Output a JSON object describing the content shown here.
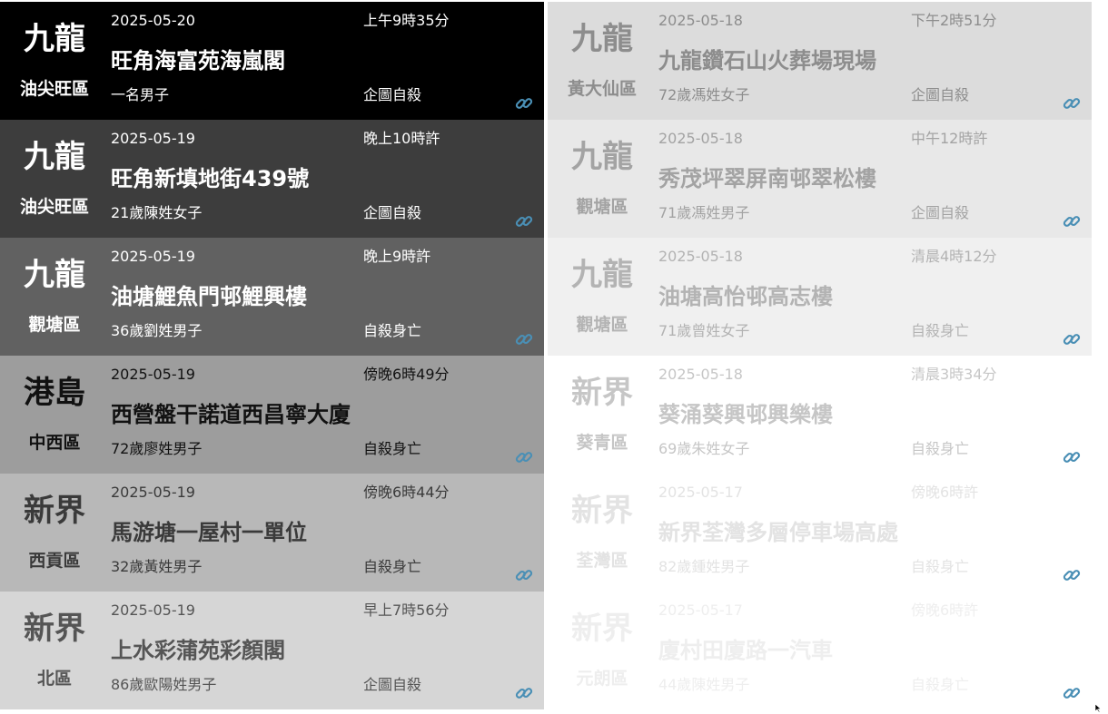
{
  "icons": {
    "link": "link-icon",
    "cursor": "mouse-pointer-icon"
  },
  "colors": {
    "link_icon": "#4a8fb5"
  },
  "left_column": [
    {
      "area": "九龍",
      "district": "油尖旺區",
      "date": "2025-05-20",
      "time": "上午9時35分",
      "place": "旺角海富苑海嵐閣",
      "person": "一名男子",
      "cause": "企圖自殺",
      "bg": "#000000",
      "fg": "#ffffff",
      "subfg": "#ffffff"
    },
    {
      "area": "九龍",
      "district": "油尖旺區",
      "date": "2025-05-19",
      "time": "晚上10時許",
      "place": "旺角新填地街439號",
      "person": "21歲陳姓女子",
      "cause": "企圖自殺",
      "bg": "#3d3d3d",
      "fg": "#ffffff",
      "subfg": "#ffffff"
    },
    {
      "area": "九龍",
      "district": "觀塘區",
      "date": "2025-05-19",
      "time": "晚上9時許",
      "place": "油塘鯉魚門邨鯉興樓",
      "person": "36歲劉姓男子",
      "cause": "自殺身亡",
      "bg": "#616161",
      "fg": "#ffffff",
      "subfg": "#ffffff"
    },
    {
      "area": "港島",
      "district": "中西區",
      "date": "2025-05-19",
      "time": "傍晚6時49分",
      "place": "西營盤干諾道西昌寧大廈",
      "person": "72歲廖姓男子",
      "cause": "自殺身亡",
      "bg": "#9d9d9d",
      "fg": "#111111",
      "subfg": "#111111"
    },
    {
      "area": "新界",
      "district": "西貢區",
      "date": "2025-05-19",
      "time": "傍晚6時44分",
      "place": "馬游塘一屋村一單位",
      "person": "32歲黃姓男子",
      "cause": "自殺身亡",
      "bg": "#b8b8b8",
      "fg": "#3a3a3a",
      "subfg": "#3a3a3a"
    },
    {
      "area": "新界",
      "district": "北區",
      "date": "2025-05-19",
      "time": "早上7時56分",
      "place": "上水彩蒲苑彩顏閣",
      "person": "86歲歐陽姓男子",
      "cause": "企圖自殺",
      "bg": "#d6d6d6",
      "fg": "#555555",
      "subfg": "#555555"
    }
  ],
  "right_column": [
    {
      "area": "九龍",
      "district": "黃大仙區",
      "date": "2025-05-18",
      "time": "下午2時51分",
      "place": "九龍鑽石山火葬場現場",
      "person": "72歲馮姓女子",
      "cause": "企圖自殺",
      "bg": "#dcdcdc",
      "fg": "#8d8d8d",
      "subfg": "#8d8d8d"
    },
    {
      "area": "九龍",
      "district": "觀塘區",
      "date": "2025-05-18",
      "time": "中午12時許",
      "place": "秀茂坪翠屏南邨翠松樓",
      "person": "71歲馮姓男子",
      "cause": "企圖自殺",
      "bg": "#e8e8e8",
      "fg": "#a3a3a3",
      "subfg": "#a3a3a3"
    },
    {
      "area": "九龍",
      "district": "觀塘區",
      "date": "2025-05-18",
      "time": "清晨4時12分",
      "place": "油塘高怡邨高志樓",
      "person": "71歲曾姓女子",
      "cause": "自殺身亡",
      "bg": "#f0f0f0",
      "fg": "#b3b3b3",
      "subfg": "#b3b3b3"
    },
    {
      "area": "新界",
      "district": "葵青區",
      "date": "2025-05-18",
      "time": "清晨3時34分",
      "place": "葵涌葵興邨興樂樓",
      "person": "69歲朱姓女子",
      "cause": "自殺身亡",
      "bg": "#ffffff",
      "fg": "#c6c6c6",
      "subfg": "#c6c6c6"
    },
    {
      "area": "新界",
      "district": "荃灣區",
      "date": "2025-05-17",
      "time": "傍晚6時許",
      "place": "新界荃灣多層停車場高處",
      "person": "82歲鍾姓男子",
      "cause": "自殺身亡",
      "bg": "#ffffff",
      "fg": "#e3e3e3",
      "subfg": "#e3e3e3"
    },
    {
      "area": "新界",
      "district": "元朗區",
      "date": "2025-05-17",
      "time": "傍晚6時許",
      "place": "廈村田廈路一汽車",
      "person": "44歲陳姓男子",
      "cause": "自殺身亡",
      "bg": "#ffffff",
      "fg": "#eeeeee",
      "subfg": "#eeeeee"
    }
  ]
}
